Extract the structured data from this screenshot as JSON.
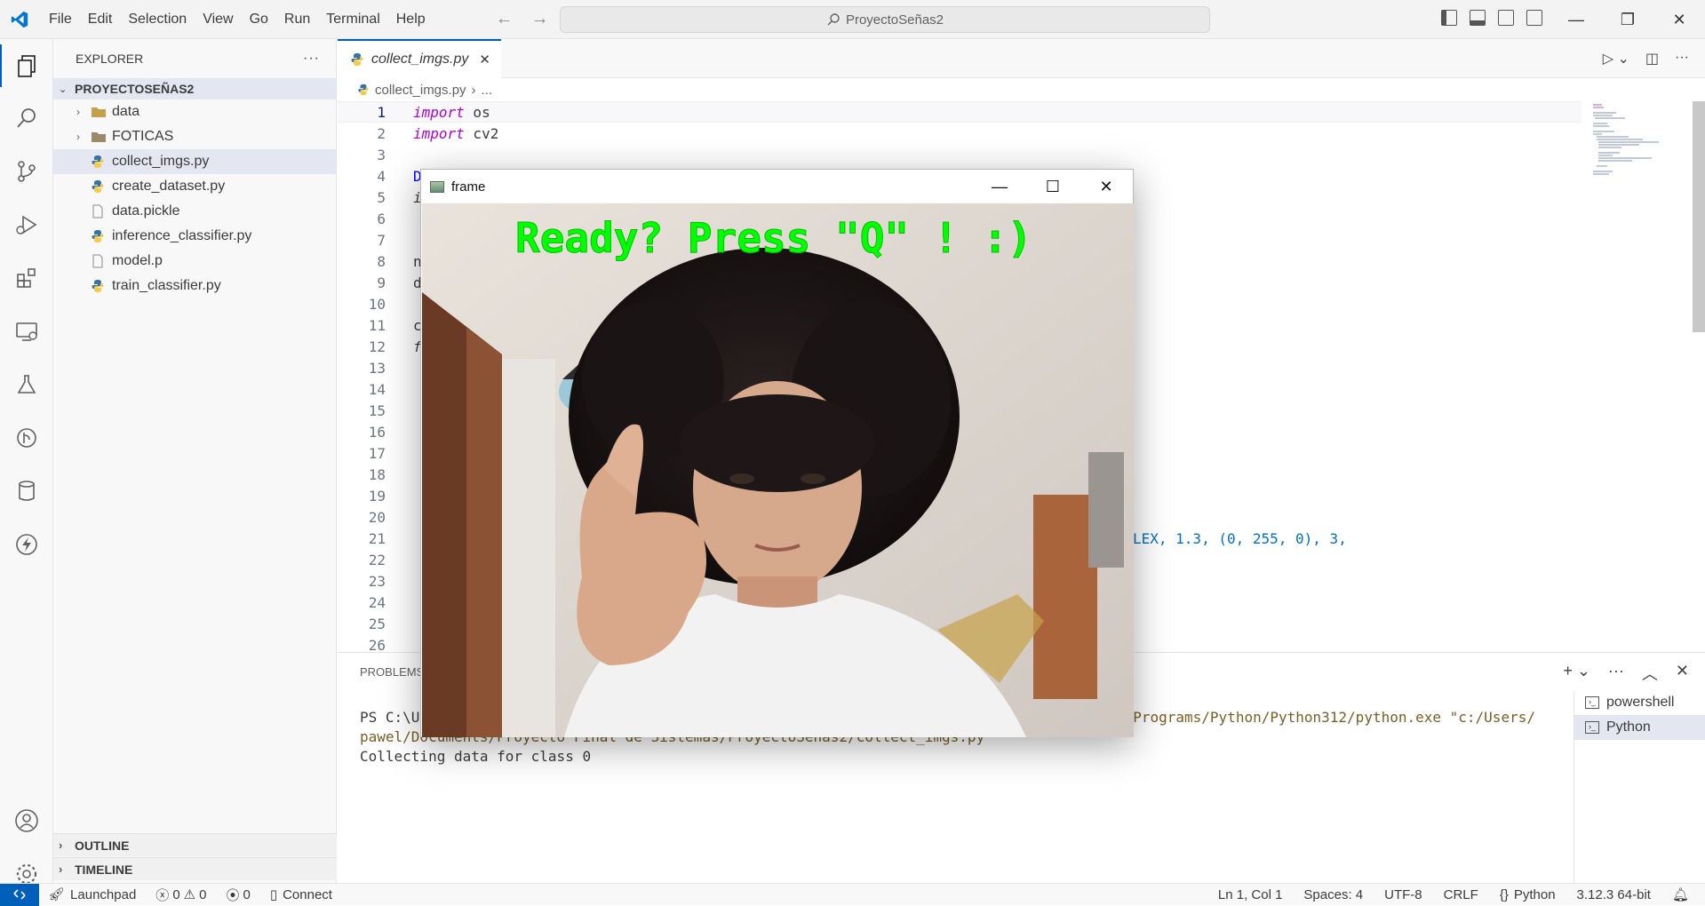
{
  "menu": [
    "File",
    "Edit",
    "Selection",
    "View",
    "Go",
    "Run",
    "Terminal",
    "Help"
  ],
  "search": {
    "text": "ProyectoSeñas2"
  },
  "sidebar": {
    "title": "EXPLORER",
    "more": "···",
    "folder": "PROYECTOSEÑAS2",
    "items": [
      {
        "label": "data",
        "kind": "folder"
      },
      {
        "label": "FOTICAS",
        "kind": "folder"
      },
      {
        "label": "collect_imgs.py",
        "kind": "python",
        "selected": true
      },
      {
        "label": "create_dataset.py",
        "kind": "python"
      },
      {
        "label": "data.pickle",
        "kind": "file"
      },
      {
        "label": "inference_classifier.py",
        "kind": "python"
      },
      {
        "label": "model.p",
        "kind": "file"
      },
      {
        "label": "train_classifier.py",
        "kind": "python"
      }
    ],
    "outline": "OUTLINE",
    "timeline": "TIMELINE"
  },
  "editor": {
    "tab_label": "collect_imgs.py",
    "breadcrumb_file": "collect_imgs.py",
    "breadcrumb_rest": "...",
    "line_numbers": [
      "1",
      "2",
      "3",
      "4",
      "5",
      "6",
      "7",
      "8",
      "9",
      "10",
      "11",
      "12",
      "13",
      "14",
      "15",
      "16",
      "17",
      "18",
      "19",
      "20",
      "21",
      "22",
      "23",
      "24",
      "25",
      "26"
    ],
    "line1_kw": "import",
    "line1_mod": " os",
    "line2_kw": "import",
    "line2_mod": " cv2",
    "line4_frag": "D",
    "line5_frag": "i",
    "line8_frag": "n",
    "line9_frag": "d",
    "line11_frag": "c",
    "line12_frag": "f",
    "line21_tail": "LEX, 1.3, (0, 255, 0), 3,"
  },
  "panel": {
    "tab": "PROBLEMS",
    "terminal_line1_prefix": "PS C:\\Us",
    "terminal_line1_suffix": "ocal/Programs/Python/Python312/python.exe \"c:/Users/",
    "terminal_line2": "pawel/Documents/Proyecto Final de Sistemas/ProyectoSeñas2/collect_imgs.py",
    "terminal_line3": "Collecting data for class 0",
    "terminals": [
      "powershell",
      "Python"
    ]
  },
  "statusbar": {
    "launchpad": "Launchpad",
    "errors": "0",
    "warnings": "0",
    "ports": "0",
    "connect": "Connect",
    "position": "Ln 1, Col 1",
    "spaces": "Spaces: 4",
    "encoding": "UTF-8",
    "eol": "CRLF",
    "language": "Python",
    "interpreter": "3.12.3 64-bit"
  },
  "frame_window": {
    "title": "frame",
    "overlay_text": "Ready? Press \"Q\" ! :)",
    "overlay_color": "#00ff00"
  },
  "colors": {
    "accent": "#005fb8",
    "keyword": "#af00db",
    "number": "#098658"
  }
}
